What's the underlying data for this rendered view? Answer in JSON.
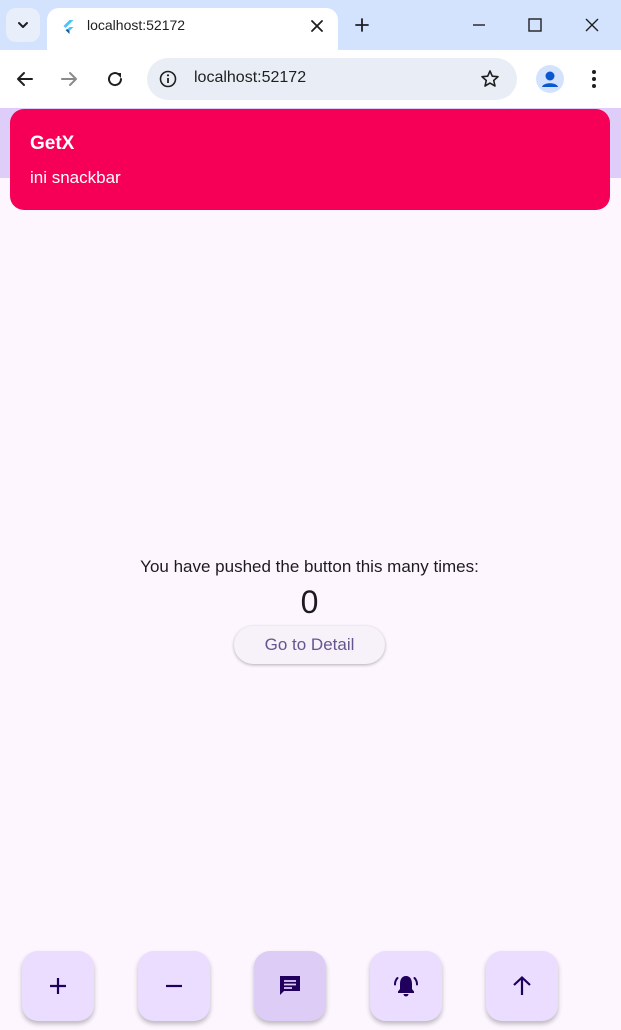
{
  "browser": {
    "tab": {
      "title": "localhost:52172"
    },
    "address_bar": {
      "url": "localhost:52172"
    }
  },
  "colors": {
    "snackbar_bg": "#f50056",
    "appbar_bg": "#ddcdf8",
    "page_bg": "#fdf6fe",
    "fab_bg": "#eaddff",
    "button_text": "#65558f"
  },
  "snackbar": {
    "title": "GetX",
    "message": "ini snackbar"
  },
  "main": {
    "counter_label": "You have pushed the button this many times:",
    "counter_value": "0",
    "detail_button_label": "Go to Detail"
  },
  "fabs": [
    {
      "icon": "plus-icon"
    },
    {
      "icon": "minus-icon"
    },
    {
      "icon": "message-icon"
    },
    {
      "icon": "bell-ringing-icon"
    },
    {
      "icon": "arrow-up-icon"
    }
  ]
}
